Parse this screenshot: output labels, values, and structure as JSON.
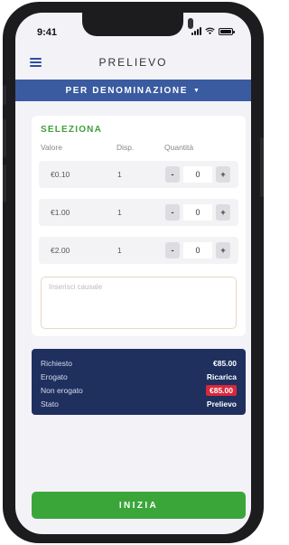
{
  "status_bar": {
    "time": "9:41"
  },
  "nav": {
    "title": "PRELIEVO"
  },
  "denomination_bar": {
    "label": "PER DENOMINAZIONE",
    "caret": "▼"
  },
  "selection": {
    "title": "SELEZIONA",
    "headers": {
      "value": "Valore",
      "available": "Disp.",
      "quantity": "Quantità"
    },
    "rows": [
      {
        "value": "€0.10",
        "available": "1",
        "quantity": "0"
      },
      {
        "value": "€1.00",
        "available": "1",
        "quantity": "0"
      },
      {
        "value": "€2.00",
        "available": "1",
        "quantity": "0"
      }
    ],
    "minus": "-",
    "plus": "+"
  },
  "causale": {
    "placeholder": "Inserisci causale"
  },
  "summary": {
    "rows": [
      {
        "label": "Richiesto",
        "value": "€85.00"
      },
      {
        "label": "Erogato",
        "value": "Ricarica"
      },
      {
        "label": "Non erogato",
        "value": "€85.00"
      },
      {
        "label": "Stato",
        "value": "Prelievo"
      }
    ]
  },
  "colors": {
    "accent_blue": "#3a5ba0",
    "summary_bg": "#1f2f5e",
    "green": "#3aa63a",
    "alert_red": "#d8283a"
  },
  "start_button": {
    "label": "INIZIA"
  }
}
